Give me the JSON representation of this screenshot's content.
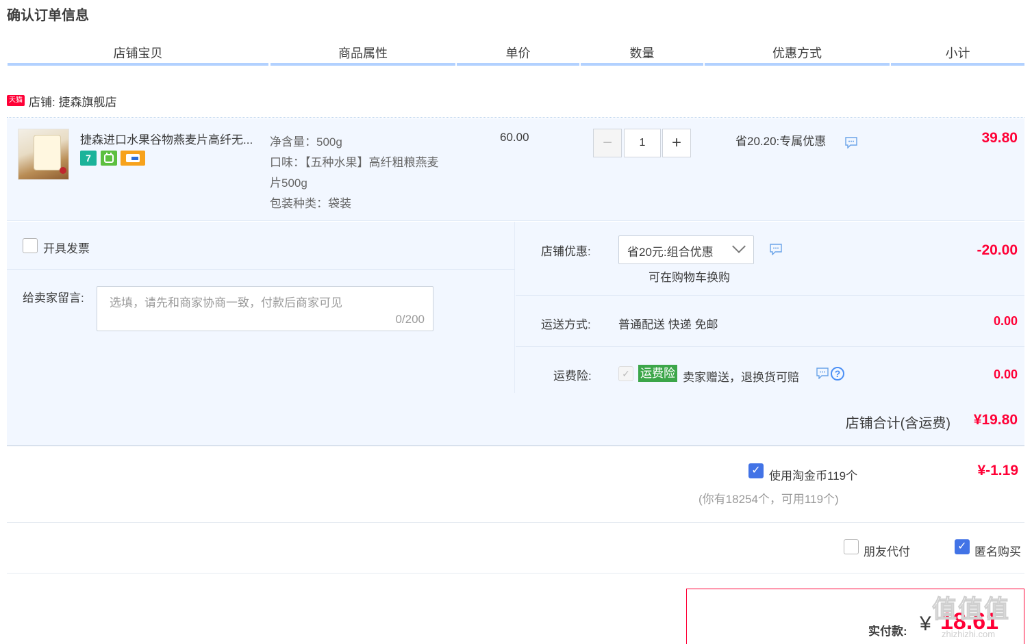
{
  "page": {
    "title": "确认订单信息"
  },
  "columns": [
    "店铺宝贝",
    "商品属性",
    "单价",
    "数量",
    "优惠方式",
    "小计"
  ],
  "shop": {
    "badge": "天猫",
    "name_prefix": "店铺:",
    "name": "捷森旗舰店"
  },
  "item": {
    "title": "捷森进口水果谷物燕麦片高纤无...",
    "service_icon_1": "7",
    "attributes": [
      "净含量：500g",
      "口味：【五种水果】高纤粗粮燕麦",
      "片500g",
      "包装种类：袋装"
    ],
    "unit_price": "60.00",
    "quantity": "1",
    "minus_label": "−",
    "plus_label": "+",
    "promotion": "省20.20:专属优惠",
    "subtotal": "39.80"
  },
  "invoice": {
    "label": "开具发票"
  },
  "memo": {
    "label": "给卖家留言:",
    "placeholder": "选填，请先和商家协商一致，付款后商家可见",
    "count": "0/200"
  },
  "shop_discount": {
    "label": "店铺优惠:",
    "selected": "省20元:组合优惠",
    "note": "可在购物车换购",
    "amount": "-20.00"
  },
  "shipping": {
    "label": "运送方式:",
    "value": "普通配送 快递 免邮",
    "amount": "0.00"
  },
  "insurance": {
    "label": "运费险:",
    "badge": "运费险",
    "text": "卖家赠送，退换货可赔",
    "help": "?",
    "amount": "0.00"
  },
  "shop_total": {
    "label": "店铺合计(含运费)",
    "amount": "¥19.80"
  },
  "coins": {
    "label": "使用淘金币119个",
    "note": "(你有18254个，可用119个)",
    "amount": "¥-1.19"
  },
  "friend_pay": {
    "label": "朋友代付"
  },
  "anonymous": {
    "label": "匿名购买"
  },
  "payment": {
    "label": "实付款:",
    "currency": "¥",
    "amount": "18.61"
  },
  "watermark": {
    "text": "值值值",
    "sub": "zhizhizhi.com"
  },
  "colors": {
    "accent": "#ff0036",
    "header_line": "#b2d1ff",
    "panel_bg": "#f2f7ff",
    "checkbox": "#4273e6",
    "insurance_badge": "#3ca649"
  },
  "icons": {
    "chat": "chat-bubble-icon",
    "check": "check-icon",
    "chevron": "chevron-down-icon",
    "help": "help-circle-icon"
  }
}
